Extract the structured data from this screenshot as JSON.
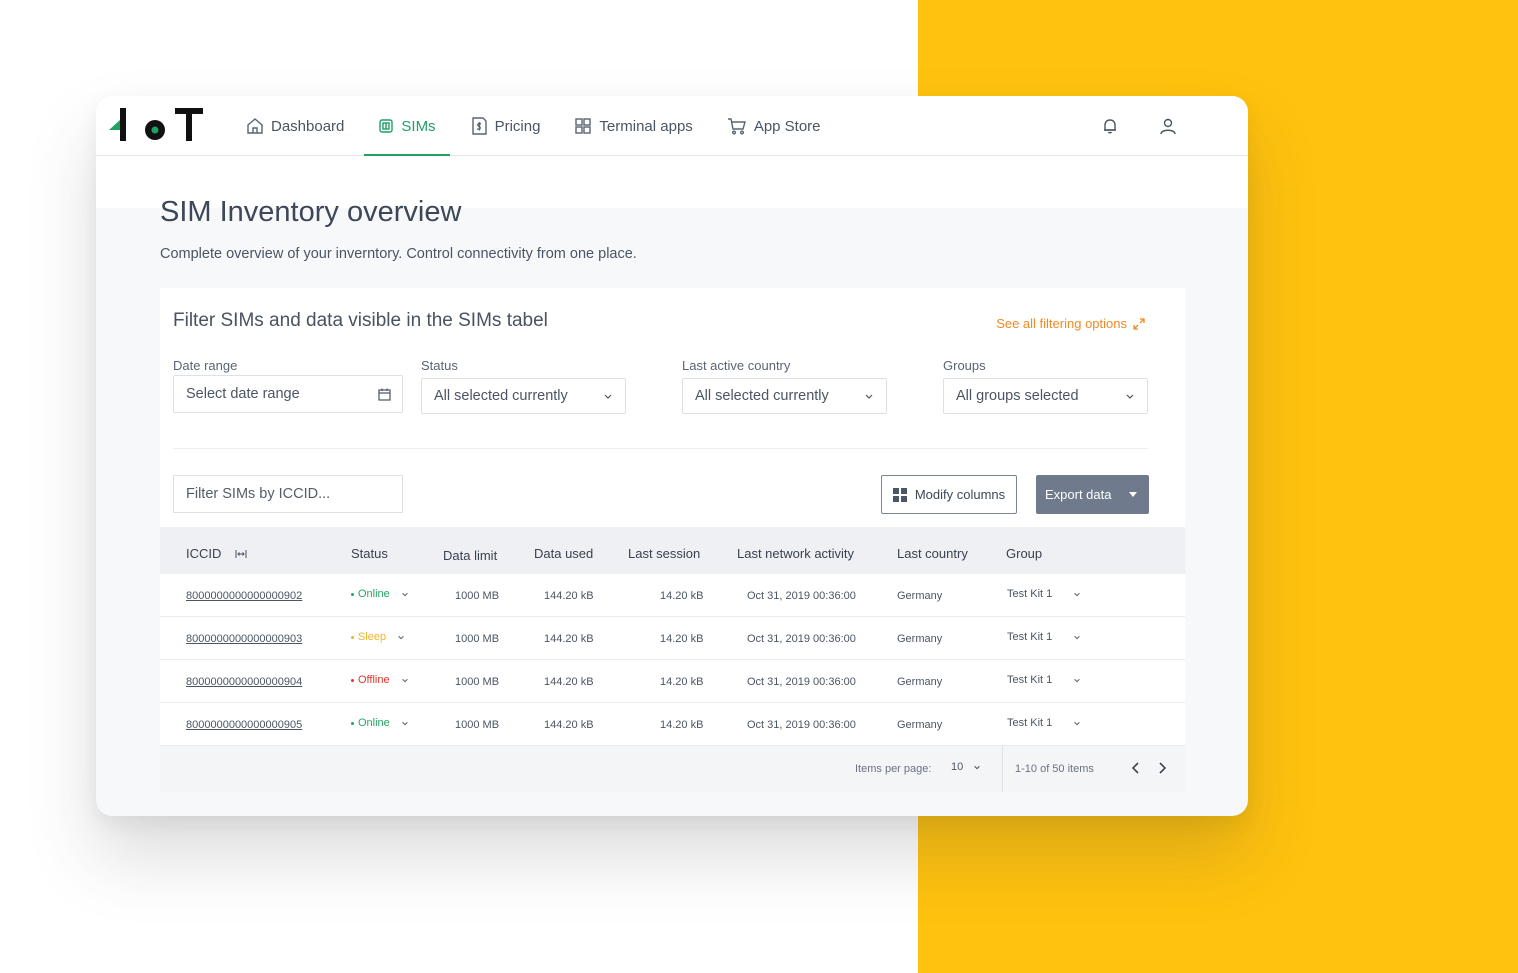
{
  "nav": {
    "items": [
      {
        "label": "Dashboard",
        "icon": "home-icon",
        "active": false
      },
      {
        "label": "SIMs",
        "icon": "sim-card-icon",
        "active": true
      },
      {
        "label": "Pricing",
        "icon": "price-tag-icon",
        "active": false
      },
      {
        "label": "Terminal apps",
        "icon": "grid-icon",
        "active": false
      },
      {
        "label": "App Store",
        "icon": "cart-icon",
        "active": false
      }
    ]
  },
  "page": {
    "title": "SIM Inventory overview",
    "subtitle": "Complete overview of your inverntory. Control connectivity from one place."
  },
  "filters": {
    "title": "Filter SIMs and data visible in the SIMs tabel",
    "link": "See all filtering options",
    "date_range": {
      "label": "Date range",
      "placeholder": "Select date range"
    },
    "status": {
      "label": "Status",
      "value": "All selected currently"
    },
    "country": {
      "label": "Last active country",
      "value": "All selected currently"
    },
    "groups": {
      "label": "Groups",
      "value": "All groups selected"
    }
  },
  "toolbar": {
    "search_placeholder": "Filter SIMs by ICCID...",
    "modify_label": "Modify columns",
    "export_label": "Export data"
  },
  "table": {
    "columns": [
      "ICCID",
      "Status",
      "Data limit",
      "Data used",
      "Last session",
      "Last network activity",
      "Last country",
      "Group"
    ],
    "rows": [
      {
        "iccid": "8000000000000000902",
        "status": "Online",
        "data_limit": "1000 MB",
        "data_used": "144.20 kB",
        "last_session": "14.20 kB",
        "last_activity": "Oct 31, 2019 00:36:00",
        "country": "Germany",
        "group": "Test Kit 1"
      },
      {
        "iccid": "8000000000000000903",
        "status": "Sleep",
        "data_limit": "1000 MB",
        "data_used": "144.20 kB",
        "last_session": "14.20 kB",
        "last_activity": "Oct 31, 2019 00:36:00",
        "country": "Germany",
        "group": "Test Kit 1"
      },
      {
        "iccid": "8000000000000000904",
        "status": "Offline",
        "data_limit": "1000 MB",
        "data_used": "144.20 kB",
        "last_session": "14.20 kB",
        "last_activity": "Oct 31, 2019 00:36:00",
        "country": "Germany",
        "group": "Test Kit 1"
      },
      {
        "iccid": "8000000000000000905",
        "status": "Online",
        "data_limit": "1000 MB",
        "data_used": "144.20 kB",
        "last_session": "14.20 kB",
        "last_activity": "Oct 31, 2019 00:36:00",
        "country": "Germany",
        "group": "Test Kit 1"
      }
    ]
  },
  "status_colors": {
    "Online": "#27a463",
    "Sleep": "#f0b429",
    "Offline": "#e5322d"
  },
  "pagination": {
    "items_per_page_label": "Items per page:",
    "items_per_page": "10",
    "range": "1-10 of 50 items"
  },
  "colors": {
    "accent": "#1fa067",
    "brand_yellow": "#ffc20e",
    "link_orange": "#f08a24"
  }
}
